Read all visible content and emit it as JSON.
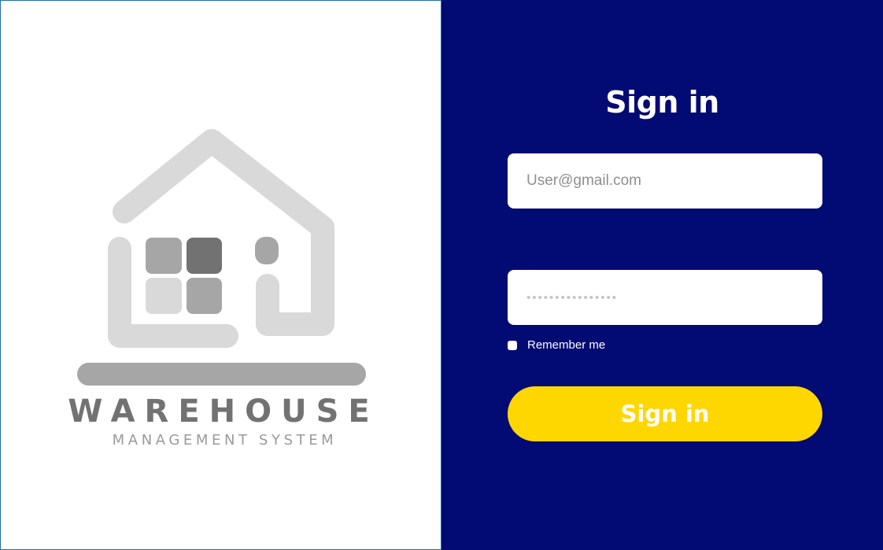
{
  "logo": {
    "icon": "warehouse-house-icon",
    "title": "WAREHOUSE",
    "subtitle": "MANAGEMENT SYSTEM",
    "colors": {
      "light_gray": "#d9d9d9",
      "mid_gray": "#a6a6a6",
      "dark_gray": "#727272"
    }
  },
  "form": {
    "heading": "Sign in",
    "email_placeholder": "User@gmail.com",
    "email_value": "",
    "password_placeholder": "••••••••••••••••",
    "password_value": "",
    "remember_label": "Remember me",
    "remember_checked": false,
    "submit_label": "Sign in"
  },
  "colors": {
    "panel_background": "#020a73",
    "button_background": "#ffd700",
    "left_border": "#1f6fa8"
  }
}
